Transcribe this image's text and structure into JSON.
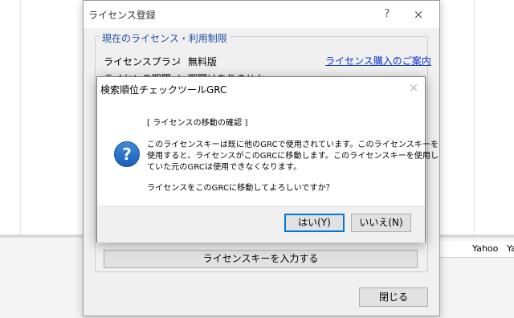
{
  "background": {
    "col_labels": [
      "Yahoo",
      "Ya"
    ]
  },
  "license_dialog": {
    "title": "ライセンス登録",
    "help": "?",
    "close_icon": "×",
    "group_title": "現在のライセンス・利用制限",
    "plan_label": "ライセンスプラン",
    "plan_sep": ":",
    "plan_value": "無料版",
    "period_label": "ライセンス期間",
    "period_sep": ":",
    "period_value": "期間はありません",
    "purchase_link": "ライセンス購入のご案内",
    "enter_key_button": "ライセンスキーを入力する",
    "close_button": "閉じる"
  },
  "confirm_dialog": {
    "title": "検索順位チェックツールGRC",
    "close_icon": "×",
    "icon": "?",
    "heading": "[ ライセンスの移動の確認 ]",
    "message_lines": [
      "このライセンスキーは既に他のGRCで使用されています。このライセンスキーを",
      "使用すると、ライセンスがこのGRCに移動します。このライセンスキーを使用し",
      "ていた元のGRCは使用できなくなります。"
    ],
    "question": "ライセンスをこのGRCに移動してよろしいですか？",
    "yes_button": "はい(Y)",
    "no_button": "いいえ(N)"
  }
}
